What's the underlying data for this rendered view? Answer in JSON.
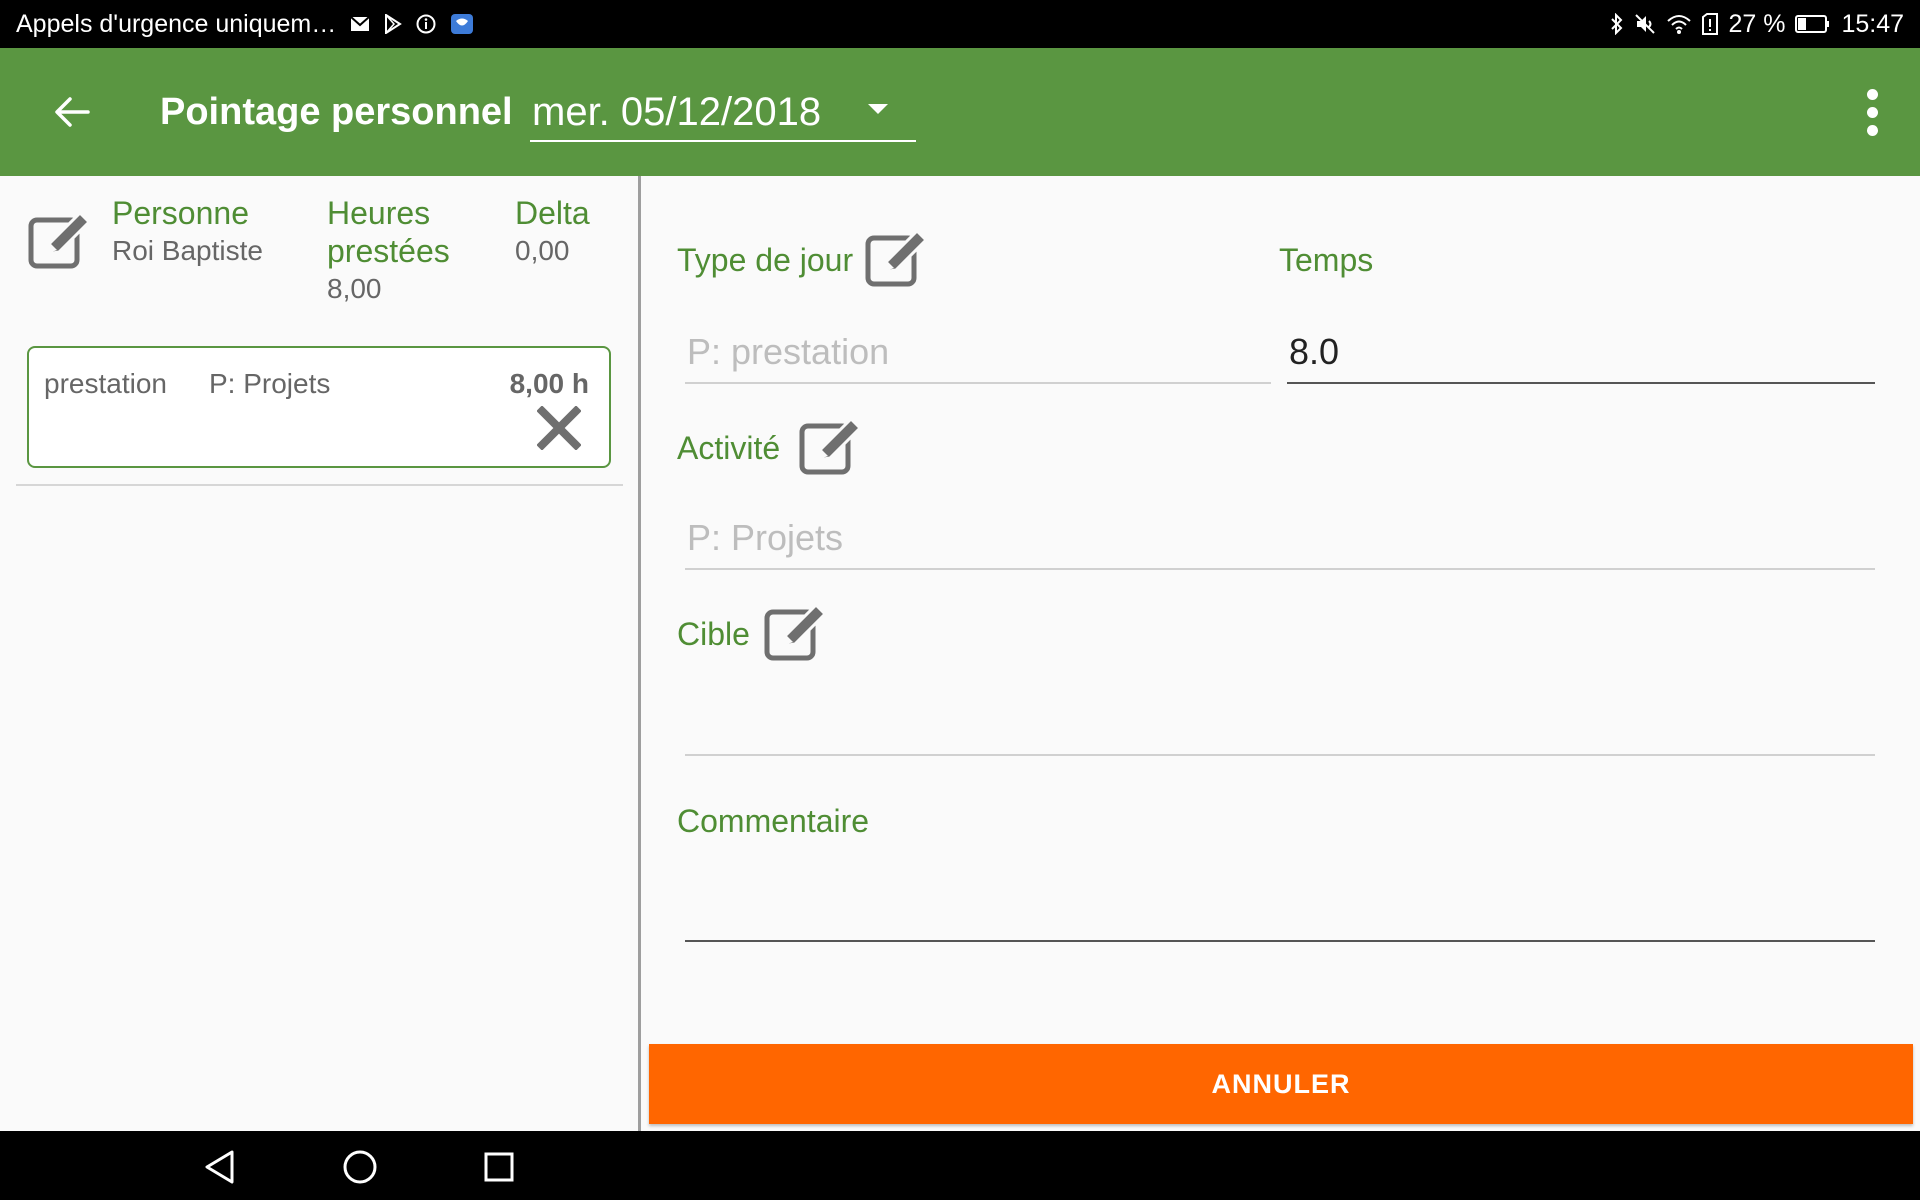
{
  "status_bar": {
    "notification_text": "Appels d'urgence uniquem…",
    "battery_percent": "27 %",
    "time": "15:47",
    "left_icons": [
      "mail-icon",
      "play-store-icon",
      "circle-info-icon",
      "app-badge-icon"
    ],
    "right_icons": [
      "bluetooth-icon",
      "mute-icon",
      "wifi-icon",
      "sim-alert-icon",
      "battery-icon"
    ]
  },
  "app_bar": {
    "title": "Pointage personnel",
    "date_value": "mer. 05/12/2018",
    "color": "#5a9641"
  },
  "summary": {
    "person_label": "Personne",
    "person_value": "Roi Baptiste",
    "hours_label_line1": "Heures",
    "hours_label_line2": "prestées",
    "hours_value": "8,00",
    "delta_label": "Delta",
    "delta_value": "0,00"
  },
  "entries": [
    {
      "type": "prestation",
      "activity": "P: Projets",
      "hours": "8,00 h"
    }
  ],
  "form": {
    "day_type_label": "Type de jour",
    "day_type_placeholder": "P: prestation",
    "time_label": "Temps",
    "time_value": "8.0",
    "activity_label": "Activité",
    "activity_placeholder": "P: Projets",
    "target_label": "Cible",
    "target_value": "",
    "comment_label": "Commentaire",
    "comment_value": "",
    "cancel_label": "ANNULER",
    "cancel_color": "#ff6600"
  }
}
